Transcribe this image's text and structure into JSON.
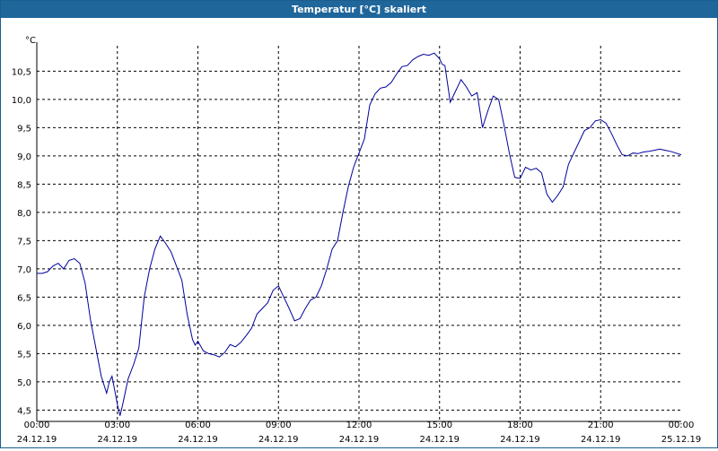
{
  "window": {
    "title": "Temperatur [°C] skaliert"
  },
  "chart_data": {
    "type": "line",
    "title": "Temperatur [°C] skaliert",
    "ylabel": "°C",
    "xlabel": "",
    "ylim": [
      4.3,
      10.95
    ],
    "xlim": [
      0,
      24
    ],
    "grid": true,
    "yticks": [
      "4,5",
      "5,0",
      "5,5",
      "6,0",
      "6,5",
      "7,0",
      "7,5",
      "8,0",
      "8,5",
      "9,0",
      "9,5",
      "10,0",
      "10,5"
    ],
    "ytick_values": [
      4.5,
      5.0,
      5.5,
      6.0,
      6.5,
      7.0,
      7.5,
      8.0,
      8.5,
      9.0,
      9.5,
      10.0,
      10.5
    ],
    "xticks": [
      {
        "time": "00:00",
        "date": "24.12.19"
      },
      {
        "time": "03:00",
        "date": "24.12.19"
      },
      {
        "time": "06:00",
        "date": "24.12.19"
      },
      {
        "time": "09:00",
        "date": "24.12.19"
      },
      {
        "time": "12:00",
        "date": "24.12.19"
      },
      {
        "time": "15:00",
        "date": "24.12.19"
      },
      {
        "time": "18:00",
        "date": "24.12.19"
      },
      {
        "time": "21:00",
        "date": "24.12.19"
      },
      {
        "time": "00:00",
        "date": "25.12.19"
      }
    ],
    "xtick_hours": [
      0,
      3,
      6,
      9,
      12,
      15,
      18,
      21,
      24
    ],
    "line_color": "#00009c",
    "series": [
      {
        "x": [
          0.0,
          0.2,
          0.4,
          0.6,
          0.8,
          1.0,
          1.2,
          1.4,
          1.6,
          1.8,
          2.0,
          2.2,
          2.4,
          2.6,
          2.7,
          2.8,
          2.9,
          3.0,
          3.1,
          3.2,
          3.4,
          3.6,
          3.8,
          4.0,
          4.2,
          4.4,
          4.6,
          4.8,
          5.0,
          5.2,
          5.4,
          5.6,
          5.8,
          5.9,
          6.0,
          6.2,
          6.4,
          6.6,
          6.8,
          7.0,
          7.2,
          7.4,
          7.6,
          7.8,
          8.0,
          8.2,
          8.4,
          8.6,
          8.8,
          9.0,
          9.2,
          9.4,
          9.6,
          9.8,
          10.0,
          10.2,
          10.4,
          10.6,
          10.8,
          11.0,
          11.2,
          11.4,
          11.6,
          11.8,
          12.0,
          12.2,
          12.4,
          12.6,
          12.8,
          13.0,
          13.2,
          13.4,
          13.6,
          13.8,
          14.0,
          14.2,
          14.4,
          14.6,
          14.8,
          15.0,
          15.1,
          15.2,
          15.4,
          15.6,
          15.8,
          16.0,
          16.2,
          16.4,
          16.6,
          16.8,
          17.0,
          17.2,
          17.4,
          17.6,
          17.8,
          18.0,
          18.2,
          18.4,
          18.6,
          18.8,
          19.0,
          19.2,
          19.4,
          19.6,
          19.8,
          20.0,
          20.2,
          20.4,
          20.6,
          20.8,
          21.0,
          21.2,
          21.4,
          21.6,
          21.8,
          22.0,
          22.2,
          22.4,
          22.6,
          22.8,
          23.0,
          23.2,
          23.4,
          23.6,
          23.8,
          24.0
        ],
        "y": [
          6.92,
          6.92,
          6.95,
          7.05,
          7.1,
          7.0,
          7.15,
          7.18,
          7.1,
          6.75,
          6.1,
          5.6,
          5.1,
          4.8,
          5.0,
          5.1,
          4.85,
          4.6,
          4.4,
          4.6,
          5.05,
          5.3,
          5.6,
          6.5,
          7.0,
          7.35,
          7.58,
          7.45,
          7.3,
          7.05,
          6.8,
          6.2,
          5.75,
          5.65,
          5.72,
          5.55,
          5.5,
          5.48,
          5.44,
          5.52,
          5.66,
          5.62,
          5.7,
          5.82,
          5.95,
          6.2,
          6.3,
          6.4,
          6.62,
          6.7,
          6.5,
          6.3,
          6.08,
          6.12,
          6.3,
          6.45,
          6.5,
          6.7,
          7.0,
          7.35,
          7.5,
          8.0,
          8.45,
          8.8,
          9.05,
          9.3,
          9.9,
          10.1,
          10.2,
          10.22,
          10.3,
          10.45,
          10.58,
          10.6,
          10.7,
          10.76,
          10.8,
          10.78,
          10.82,
          10.72,
          10.62,
          10.6,
          9.95,
          10.15,
          10.35,
          10.22,
          10.06,
          10.12,
          9.5,
          9.8,
          10.06,
          10.0,
          9.55,
          9.05,
          8.62,
          8.6,
          8.8,
          8.75,
          8.78,
          8.7,
          8.32,
          8.18,
          8.3,
          8.45,
          8.85,
          9.05,
          9.25,
          9.45,
          9.5,
          9.62,
          9.64,
          9.58,
          9.4,
          9.2,
          9.02,
          9.0,
          9.05,
          9.04,
          9.07,
          9.08,
          9.1,
          9.12,
          9.1,
          9.08,
          9.05,
          9.02
        ]
      }
    ]
  }
}
